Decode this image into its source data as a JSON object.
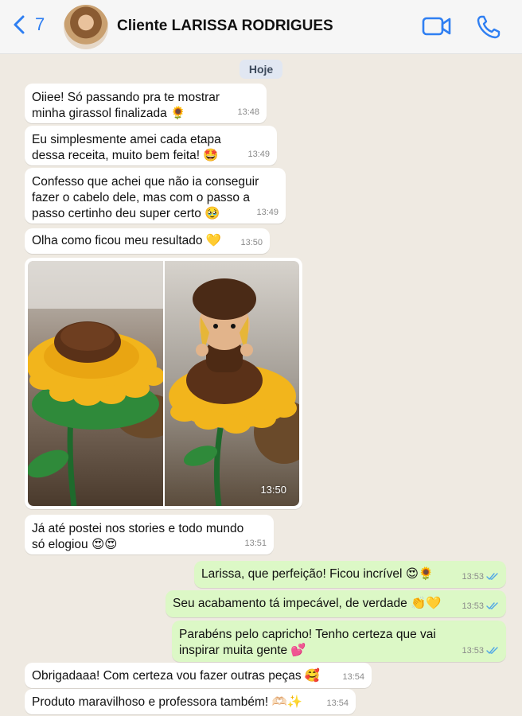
{
  "header": {
    "back_count": "7",
    "contact_name": "Cliente LARISSA RODRIGUES",
    "icons": [
      "chevron-left-icon",
      "video-call-icon",
      "phone-icon"
    ]
  },
  "date_chip": "Hoje",
  "messages": [
    {
      "dir": "in",
      "text": "Oiiee! Só passando pra te mostrar\nminha girassol finalizada 🌻",
      "time": "13:48"
    },
    {
      "dir": "in",
      "text": "Eu simplesmente amei cada etapa\ndessa receita, muito bem feita! 🤩",
      "time": "13:49"
    },
    {
      "dir": "in",
      "text": "Confesso que achei que não ia conseguir\nfazer o cabelo dele, mas com o passo a\npasso certinho deu super certo 🥹",
      "time": "13:49"
    },
    {
      "dir": "in",
      "text": "Olha como ficou meu resultado 💛",
      "time": "13:50"
    },
    {
      "dir": "in",
      "type": "image",
      "time": "13:50"
    },
    {
      "dir": "in",
      "text": "Já até postei nos stories e todo mundo\nsó elogiou 😍😍",
      "time": "13:51"
    },
    {
      "dir": "out",
      "text": "Larissa, que perfeição! Ficou incrível 😍🌻",
      "time": "13:53"
    },
    {
      "dir": "out",
      "text": "Seu acabamento tá impecável, de verdade 👏💛",
      "time": "13:53"
    },
    {
      "dir": "out",
      "text": "Parabéns pelo capricho! Tenho certeza que vai\ninspirar muita gente 💕",
      "time": "13:53"
    },
    {
      "dir": "in",
      "text": "Obrigadaaa! Com certeza vou fazer outras peças 🥰",
      "time": "13:54"
    },
    {
      "dir": "in",
      "text": "Produto maravilhoso e professora também! 🫶🏻✨",
      "time": "13:54"
    }
  ],
  "colors": {
    "accent": "#2f7ff2",
    "chat_bg": "#efeae2",
    "incoming_bubble": "#ffffff",
    "outgoing_bubble": "#dcf8c6",
    "read_ticks": "#4fa6e6"
  }
}
